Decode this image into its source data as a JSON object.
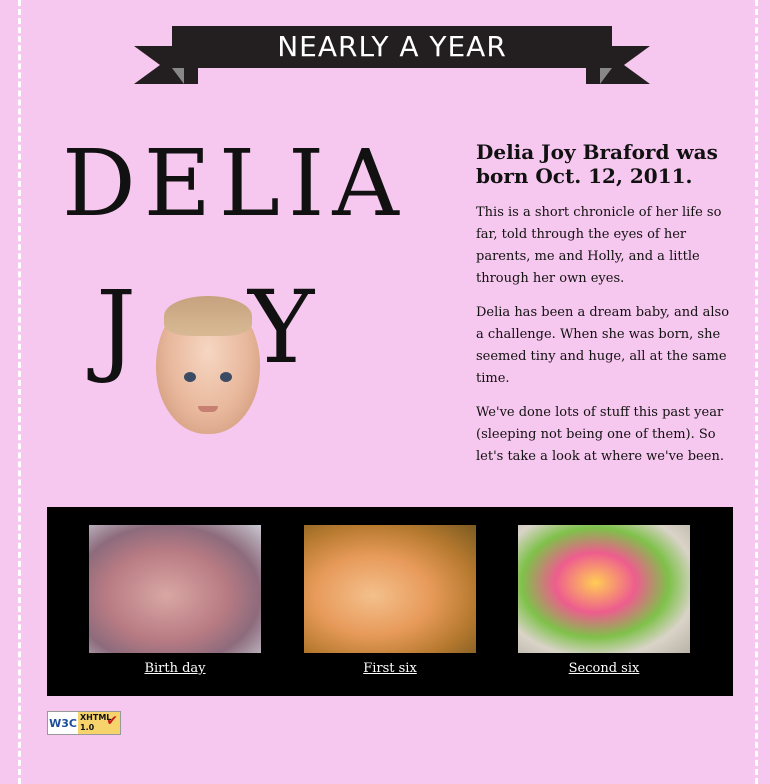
{
  "banner": {
    "title": "NEARLY A YEAR"
  },
  "hero": {
    "line1": "DELIA",
    "line2_left": "J",
    "line2_right": "Y"
  },
  "intro": {
    "heading": "Delia Joy Braford was born Oct. 12, 2011.",
    "paragraphs": [
      "This is a short chronicle of her life so far, told through the eyes of her parents, me and Holly, and a little through her own eyes.",
      "Delia has been a dream baby, and also a challenge. When she was born, she seemed tiny and huge, all at the same time.",
      "We've done lots of stuff this past year (sleeping not being one of them). So let's take a look at where we've been."
    ]
  },
  "gallery": {
    "items": [
      {
        "label": "Birth day"
      },
      {
        "label": "First six"
      },
      {
        "label": "Second six"
      }
    ]
  },
  "badge": {
    "org": "W3C",
    "name": "XHTML",
    "version": "1.0"
  },
  "colors": {
    "page_background": "#f7c8ef",
    "banner": "#231f20",
    "gallery_background": "#000000",
    "link": "#ffffff"
  }
}
